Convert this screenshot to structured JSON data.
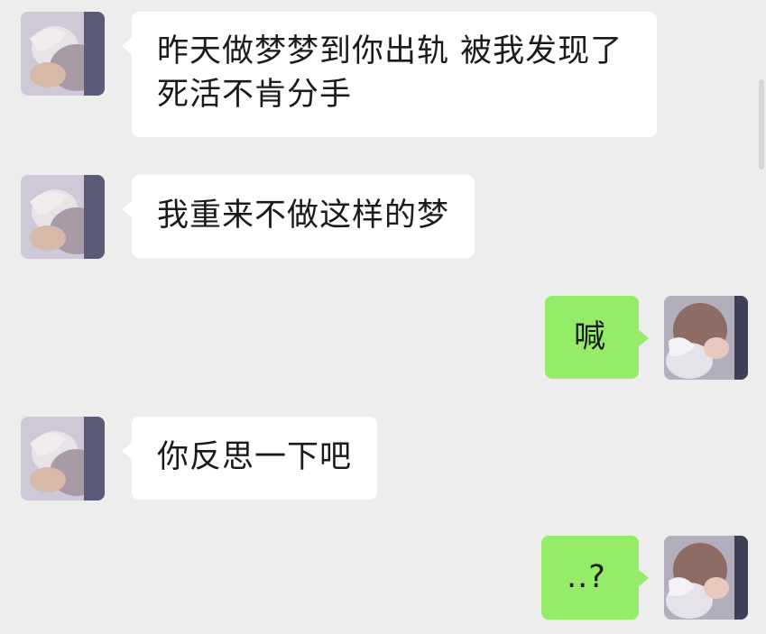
{
  "messages": [
    {
      "direction": "incoming",
      "avatar": "contact-avatar",
      "text": "昨天做梦梦到你出轨 被我发现了 死活不肯分手"
    },
    {
      "direction": "incoming",
      "avatar": "contact-avatar",
      "text": "我重来不做这样的梦"
    },
    {
      "direction": "outgoing",
      "avatar": "self-avatar",
      "text": "喊"
    },
    {
      "direction": "incoming",
      "avatar": "contact-avatar",
      "text": "你反思一下吧"
    },
    {
      "direction": "outgoing",
      "avatar": "self-avatar",
      "text": "..?"
    }
  ],
  "colors": {
    "background": "#ededed",
    "incoming_bubble": "#ffffff",
    "outgoing_bubble": "#95ec69",
    "text": "#1a1a1a"
  }
}
